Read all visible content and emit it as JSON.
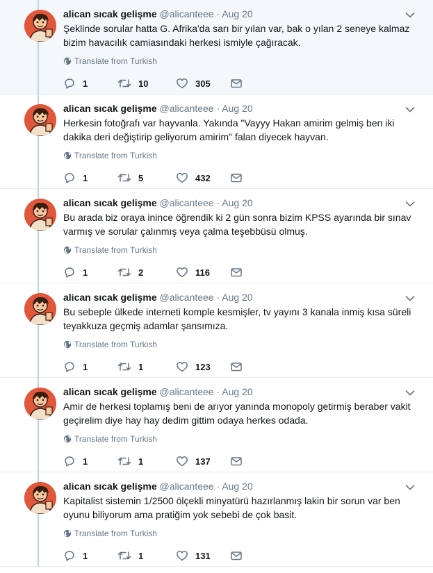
{
  "colors": {
    "accent": "#1da1f2",
    "thread_line": "#b8d5ec",
    "muted": "#657786",
    "highlight_bg": "#f5f8fa",
    "avatar_bg": "#e1573b"
  },
  "icons": {
    "reply": "reply-icon",
    "retweet": "retweet-icon",
    "like": "heart-icon",
    "dm": "envelope-icon",
    "translate": "globe-icon",
    "menu": "chevron-down-icon"
  },
  "tweets": [
    {
      "name": "alican sıcak gelişme",
      "handle": "@alicanteee",
      "dot": "·",
      "date": "Aug 20",
      "text": "Şeklinde sorular hatta G. Afrika'da sarı bir yılan var, bak o yılan 2 seneye kalmaz bizim havacılık camiasındaki herkesi ismiyle çağıracak.",
      "translate": "Translate from Turkish",
      "replies": "1",
      "retweets": "10",
      "likes": "305"
    },
    {
      "name": "alican sıcak gelişme",
      "handle": "@alicanteee",
      "dot": "·",
      "date": "Aug 20",
      "text": "Herkesin fotoğrafı var hayvanla. Yakında \"Vayyy Hakan amirim gelmiş ben iki dakika deri değiştirip geliyorum amirim\" falan diyecek hayvan.",
      "translate": "Translate from Turkish",
      "replies": "1",
      "retweets": "5",
      "likes": "432"
    },
    {
      "name": "alican sıcak gelişme",
      "handle": "@alicanteee",
      "dot": "·",
      "date": "Aug 20",
      "text": "Bu arada biz oraya inince öğrendik ki 2 gün sonra bizim KPSS ayarında bir sınav varmış ve sorular çalınmış veya çalma teşebbüsü olmuş.",
      "translate": "Translate from Turkish",
      "replies": "1",
      "retweets": "2",
      "likes": "116"
    },
    {
      "name": "alican sıcak gelişme",
      "handle": "@alicanteee",
      "dot": "·",
      "date": "Aug 20",
      "text": "Bu sebeple ülkede interneti komple kesmişler, tv yayını 3 kanala inmiş kısa süreli teyakkuza geçmiş adamlar şansımıza.",
      "translate": "Translate from Turkish",
      "replies": "1",
      "retweets": "1",
      "likes": "123"
    },
    {
      "name": "alican sıcak gelişme",
      "handle": "@alicanteee",
      "dot": "·",
      "date": "Aug 20",
      "text": "Amir de herkesi toplamış beni de arıyor yanında monopoly getirmiş beraber vakit geçirelim diye hay hay dedim gittim odaya herkes odada.",
      "translate": "Translate from Turkish",
      "replies": "1",
      "retweets": "1",
      "likes": "137"
    },
    {
      "name": "alican sıcak gelişme",
      "handle": "@alicanteee",
      "dot": "·",
      "date": "Aug 20",
      "text": "Kapitalist sistemin 1/2500 ölçekli minyatürü hazırlanmış lakin bir sorun var ben oyunu biliyorum ama pratiğim yok sebebi de çok basit.",
      "translate": "Translate from Turkish",
      "replies": "1",
      "retweets": "1",
      "likes": "131"
    }
  ]
}
